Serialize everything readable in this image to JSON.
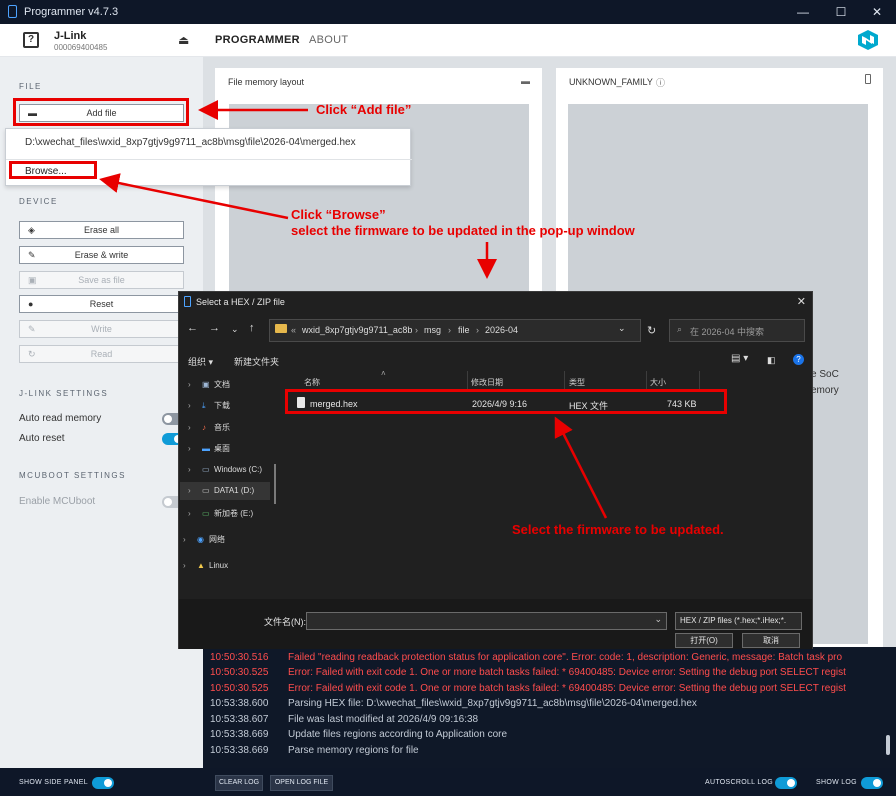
{
  "window": {
    "title": "Programmer v4.7.3",
    "controls": [
      "—",
      "☐",
      "✕"
    ]
  },
  "header": {
    "device_name": "J-Link",
    "device_serial": "000069400485",
    "tabs": [
      {
        "label": "PROGRAMMER",
        "active": true
      },
      {
        "label": "ABOUT",
        "active": false
      }
    ]
  },
  "side_panel": {
    "file_section": "FILE",
    "add_file_label": "Add file",
    "recent_file": "D:\\xwechat_files\\wxid_8xp7gtjv9g9711_ac8b\\msg\\file\\2026-04\\merged.hex",
    "browse_label": "Browse...",
    "device_section": "DEVICE",
    "buttons": [
      {
        "label": "Erase all",
        "enabled": true
      },
      {
        "label": "Erase & write",
        "enabled": true
      },
      {
        "label": "Save as file",
        "enabled": false
      },
      {
        "label": "Reset",
        "enabled": true
      },
      {
        "label": "Write",
        "enabled": false
      },
      {
        "label": "Read",
        "enabled": false
      }
    ],
    "jlink_section": "J-LINK SETTINGS",
    "auto_read_memory": {
      "label": "Auto read memory",
      "on": false
    },
    "auto_reset": {
      "label": "Auto reset",
      "on": true
    },
    "mcuboot_section": "MCUBOOT SETTINGS",
    "enable_mcuboot": {
      "label": "Enable MCUboot",
      "on": false
    }
  },
  "main": {
    "card1_title": "File memory layout",
    "card2_title": "UNKNOWN_FAMILY",
    "partial_text_line1": "e SoC",
    "partial_text_line2": "emory"
  },
  "dialog": {
    "title": "Select a HEX / ZIP file",
    "address": [
      "«",
      "wxid_8xp7gtjv9g9711_ac8b",
      "msg",
      "file",
      "2026-04"
    ],
    "search_placeholder": "在 2026-04 中搜索",
    "organize": "组织 ▾",
    "new_folder": "新建文件夹",
    "tree": [
      {
        "label": "文档",
        "icon": "document-icon"
      },
      {
        "label": "下载",
        "icon": "download-icon"
      },
      {
        "label": "音乐",
        "icon": "music-icon"
      },
      {
        "label": "桌面",
        "icon": "desktop-icon"
      },
      {
        "label": "Windows (C:)",
        "icon": "drive-icon"
      },
      {
        "label": "DATA1 (D:)",
        "icon": "drive-icon"
      },
      {
        "label": "新加卷 (E:)",
        "icon": "drive-icon"
      },
      {
        "label": "网络",
        "icon": "network-icon"
      },
      {
        "label": "Linux",
        "icon": "linux-icon"
      }
    ],
    "columns": [
      "名称",
      "修改日期",
      "类型",
      "大小"
    ],
    "files": [
      {
        "name": "merged.hex",
        "modified": "2026/4/9 9:16",
        "type": "HEX 文件",
        "size": "743 KB"
      }
    ],
    "filename_label": "文件名(N):",
    "filename_value": "",
    "filetype": "HEX / ZIP files (*.hex;*.iHex;*.",
    "open_button": "打开(O)",
    "cancel_button": "取消"
  },
  "log": [
    {
      "time": "10:50:30.516",
      "msg": "Failed \"reading readback protection status for application core\". Error: code: 1, description: Generic, message: Batch task pro",
      "error": true
    },
    {
      "time": "10:50:30.525",
      "msg": "Error: Failed with exit code 1. One or more batch tasks failed: * 69400485: Device error: Setting the debug port SELECT regist",
      "error": true
    },
    {
      "time": "10:50:30.525",
      "msg": "Error: Failed with exit code 1. One or more batch tasks failed: * 69400485: Device error: Setting the debug port SELECT regist",
      "error": true
    },
    {
      "time": "10:53:38.600",
      "msg": "Parsing HEX file: D:\\xwechat_files\\wxid_8xp7gtjv9g9711_ac8b\\msg\\file\\2026-04\\merged.hex",
      "error": false
    },
    {
      "time": "10:53:38.607",
      "msg": "File was last modified at 2026/4/9 09:16:38",
      "error": false
    },
    {
      "time": "10:53:38.669",
      "msg": "Update files regions according to Application core",
      "error": false
    },
    {
      "time": "10:53:38.669",
      "msg": "Parse memory regions for file",
      "error": false
    }
  ],
  "bottom_bar": {
    "show_side_panel": "SHOW SIDE PANEL",
    "clear_log": "CLEAR LOG",
    "open_log_file": "OPEN LOG FILE",
    "autoscroll_log": "AUTOSCROLL LOG",
    "show_log": "SHOW LOG"
  },
  "annotations": {
    "add_file": "Click “Add file”",
    "browse_line1": "Click “Browse”",
    "browse_line2": "select the firmware to be updated in the pop-up window",
    "select_firmware": "Select the firmware to be updated."
  },
  "colors": {
    "accent": "#0f9bd7",
    "error_text": "#ff4d4d",
    "annotation": "#e80000",
    "dark_bg": "#0e1728"
  }
}
